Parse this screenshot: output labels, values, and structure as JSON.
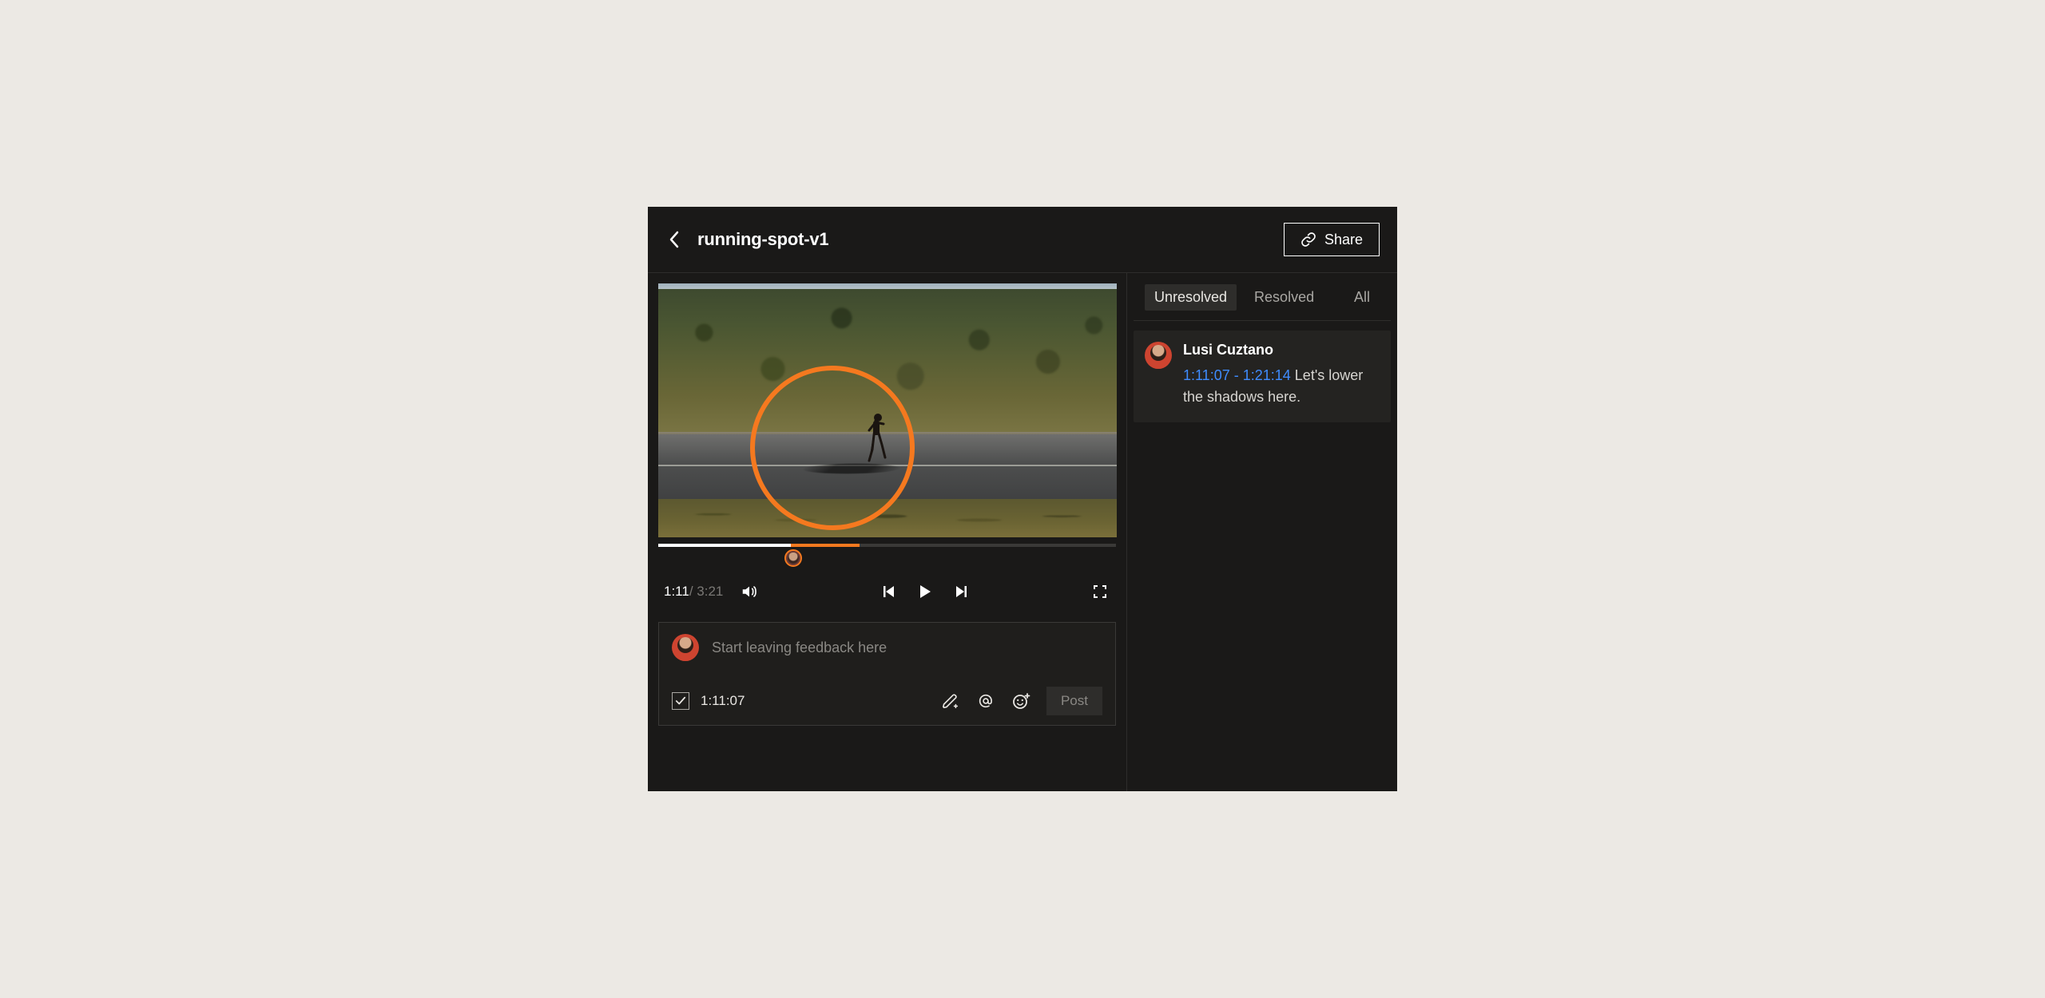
{
  "header": {
    "title": "running-spot-v1",
    "share_label": "Share"
  },
  "player": {
    "current_time": "1:11",
    "total_time": "3:21"
  },
  "composer": {
    "placeholder": "Start leaving feedback here",
    "timestamp": "1:11:07",
    "post_label": "Post"
  },
  "filters": {
    "items": [
      {
        "label": "Unresolved",
        "active": true
      },
      {
        "label": "Resolved",
        "active": false
      },
      {
        "label": "All",
        "active": false
      }
    ]
  },
  "comments": [
    {
      "author": "Lusi Cuztano",
      "range": "1:11:07 - 1:21:14",
      "text": "Let's lower the shadows here."
    }
  ],
  "colors": {
    "accent": "#f5791f",
    "link": "#3f8cff"
  }
}
